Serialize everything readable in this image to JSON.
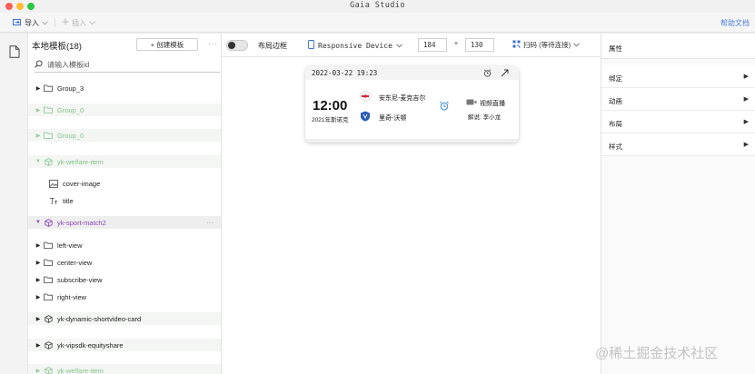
{
  "window": {
    "title": "Gaia Studio"
  },
  "toolbar": {
    "import_label": "导入",
    "insert_label": "插入",
    "help_label": "帮助文档"
  },
  "panel": {
    "title": "本地模板(18)",
    "create_label": "+ 创建模板",
    "more_label": "···",
    "search_placeholder": "请输入模板id",
    "items": [
      {
        "label": "Group_3"
      },
      {
        "label": "Group_0"
      },
      {
        "label": "Group_0"
      },
      {
        "label": "yk-welfare-item"
      },
      {
        "label": "cover-image"
      },
      {
        "label": "title"
      },
      {
        "label": "yk-sport-match2",
        "more": "···"
      },
      {
        "label": "left-view"
      },
      {
        "label": "center-view"
      },
      {
        "label": "subscribe-view"
      },
      {
        "label": "right-view"
      },
      {
        "label": "yk-dynamic-shortvideo-card"
      },
      {
        "label": "yk-vipsdk-equityshare"
      },
      {
        "label": "yk-welfare-item"
      }
    ]
  },
  "canvas": {
    "border_toggle_label": "布局边框",
    "border_toggle_on": false,
    "device_label": "Responsive Device",
    "width_value": "184",
    "times": "×",
    "height_value": "130",
    "scan_label": "扫码 (等待连接)"
  },
  "card": {
    "datetime": "2022-03-22 19:23",
    "time": "12:00",
    "league": "2021年斯诺克",
    "team1": "安东尼-麦克吉尔",
    "team2": "里奇-沃顿",
    "live_label": "视频直播",
    "commentary": "解说: 李小龙"
  },
  "inspector": {
    "title": "属性",
    "rows": [
      {
        "label": "绑定"
      },
      {
        "label": "动画"
      },
      {
        "label": "布局"
      },
      {
        "label": "样式"
      }
    ]
  },
  "watermark": "@稀土掘金技术社区",
  "colors": {
    "accent": "#4a7fd8",
    "green": "#86c28e",
    "purple": "#8a45b6"
  }
}
